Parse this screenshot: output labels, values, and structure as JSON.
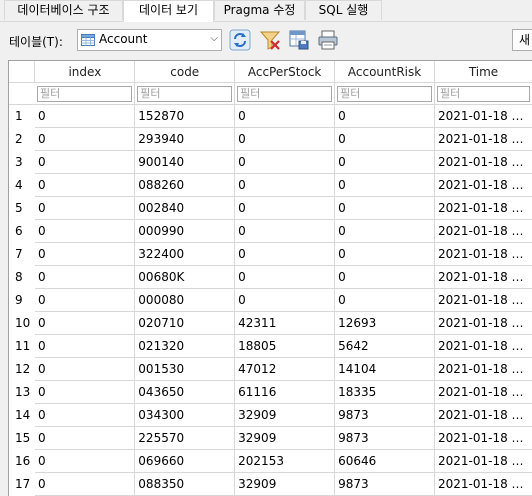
{
  "tabs": [
    {
      "label": "데이터베이스 구조",
      "active": false
    },
    {
      "label": "데이터 보기",
      "active": true
    },
    {
      "label": "Pragma 수정",
      "active": false
    },
    {
      "label": "SQL 실행",
      "active": false
    }
  ],
  "toolbar": {
    "table_label": "테이블(T):",
    "table_select": "Account",
    "right_button": "새"
  },
  "grid": {
    "columns": [
      "index",
      "code",
      "AccPerStock",
      "AccountRisk",
      "Time"
    ],
    "filter_placeholder": "필터",
    "rows": [
      [
        "1",
        "0",
        "152870",
        "0",
        "0",
        "2021-01-18 …"
      ],
      [
        "2",
        "0",
        "293940",
        "0",
        "0",
        "2021-01-18 …"
      ],
      [
        "3",
        "0",
        "900140",
        "0",
        "0",
        "2021-01-18 …"
      ],
      [
        "4",
        "0",
        "088260",
        "0",
        "0",
        "2021-01-18 …"
      ],
      [
        "5",
        "0",
        "002840",
        "0",
        "0",
        "2021-01-18 …"
      ],
      [
        "6",
        "0",
        "000990",
        "0",
        "0",
        "2021-01-18 …"
      ],
      [
        "7",
        "0",
        "322400",
        "0",
        "0",
        "2021-01-18 …"
      ],
      [
        "8",
        "0",
        "00680K",
        "0",
        "0",
        "2021-01-18 …"
      ],
      [
        "9",
        "0",
        "000080",
        "0",
        "0",
        "2021-01-18 …"
      ],
      [
        "10",
        "0",
        "020710",
        "42311",
        "12693",
        "2021-01-18 …"
      ],
      [
        "11",
        "0",
        "021320",
        "18805",
        "5642",
        "2021-01-18 …"
      ],
      [
        "12",
        "0",
        "001530",
        "47012",
        "14104",
        "2021-01-18 …"
      ],
      [
        "13",
        "0",
        "043650",
        "61116",
        "18335",
        "2021-01-18 …"
      ],
      [
        "14",
        "0",
        "034300",
        "32909",
        "9873",
        "2021-01-18 …"
      ],
      [
        "15",
        "0",
        "225570",
        "32909",
        "9873",
        "2021-01-18 …"
      ],
      [
        "16",
        "0",
        "069660",
        "202153",
        "60646",
        "2021-01-18 …"
      ],
      [
        "17",
        "0",
        "088350",
        "32909",
        "9873",
        "2021-01-18 …"
      ]
    ]
  }
}
